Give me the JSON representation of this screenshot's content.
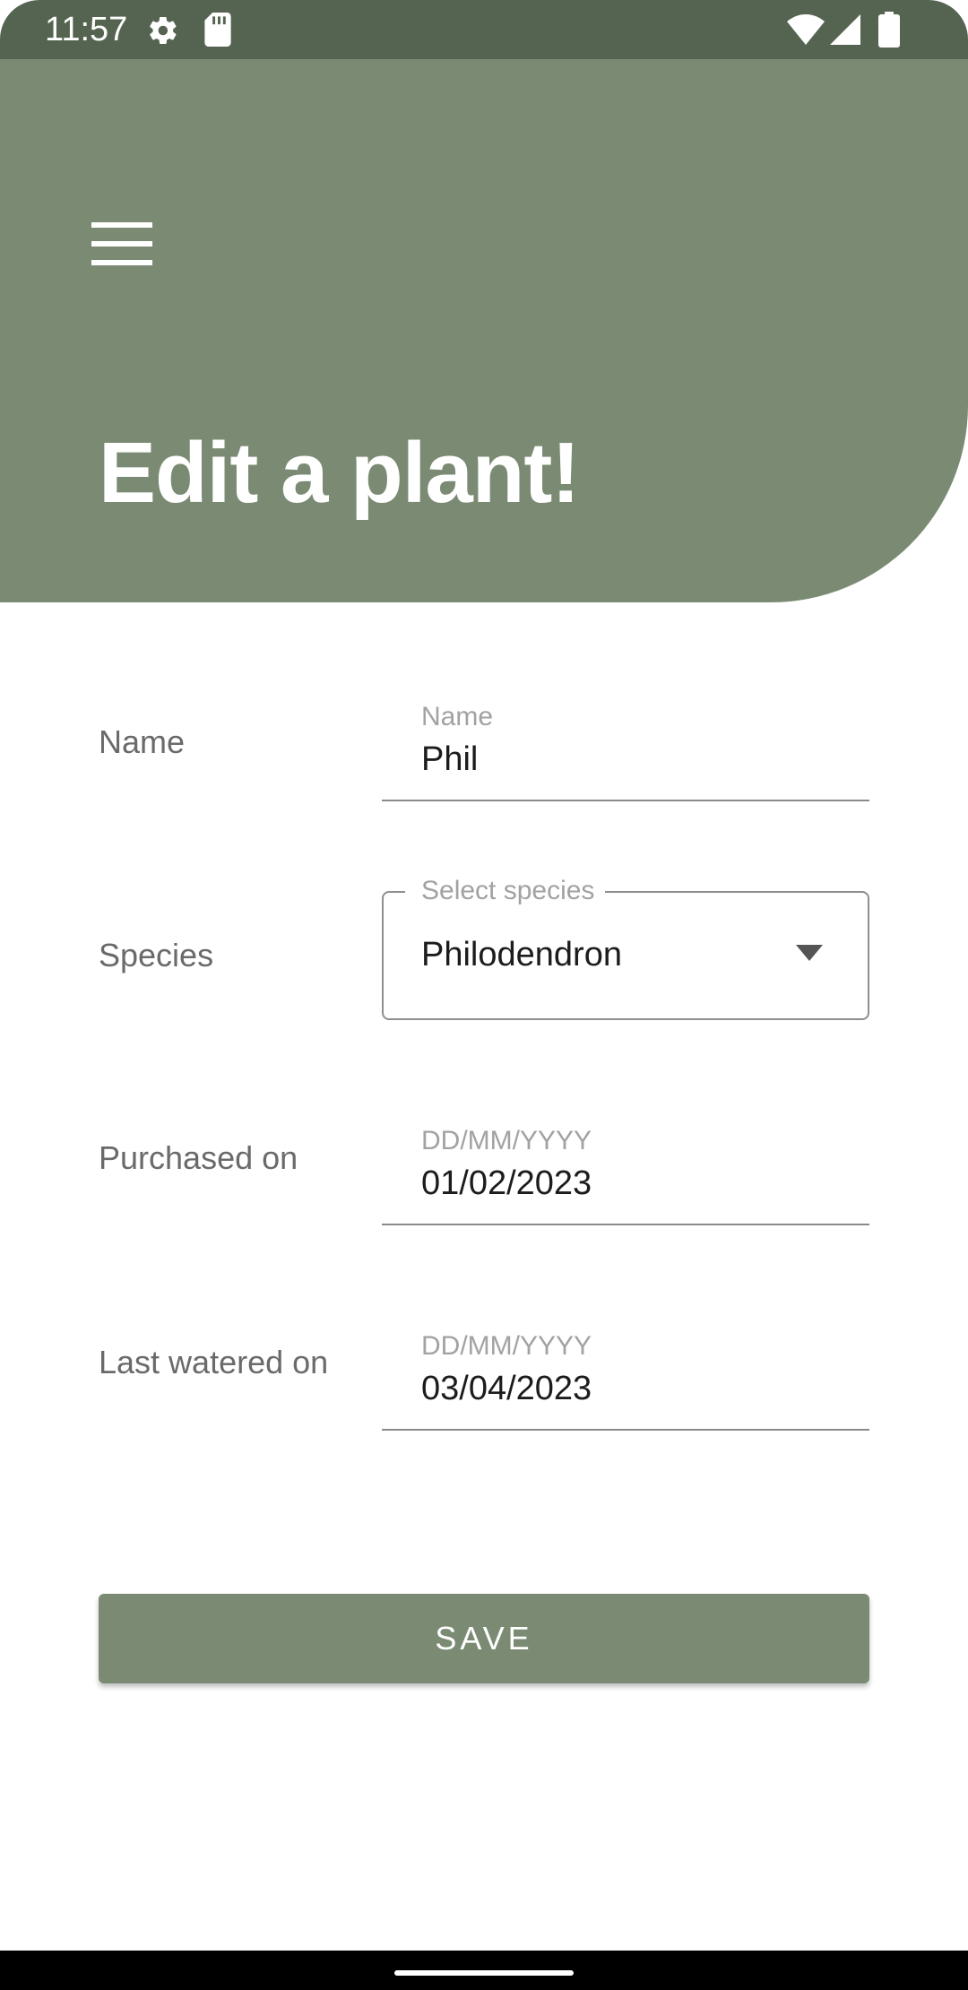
{
  "status_bar": {
    "time": "11:57",
    "icons": [
      "gear-icon",
      "sd-card-icon",
      "wifi-icon",
      "signal-icon",
      "battery-icon"
    ]
  },
  "header": {
    "menu_icon": "hamburger-menu-icon",
    "title": "Edit a plant!"
  },
  "form": {
    "name": {
      "label": "Name",
      "floating_label": "Name",
      "value": "Phil"
    },
    "species": {
      "label": "Species",
      "floating_label": "Select species",
      "value": "Philodendron",
      "icon": "dropdown-arrow-icon"
    },
    "purchased_on": {
      "label": "Purchased on",
      "floating_label": "DD/MM/YYYY",
      "value": "01/02/2023"
    },
    "last_watered_on": {
      "label": "Last watered on",
      "floating_label": "DD/MM/YYYY",
      "value": "03/04/2023"
    }
  },
  "actions": {
    "save_label": "SAVE"
  },
  "colors": {
    "header_green": "#7b8b73",
    "status_bar_green": "#556450",
    "button_green": "#7b8b73",
    "label_gray": "#6a6a6a",
    "hint_gray": "#a2a2a2"
  }
}
